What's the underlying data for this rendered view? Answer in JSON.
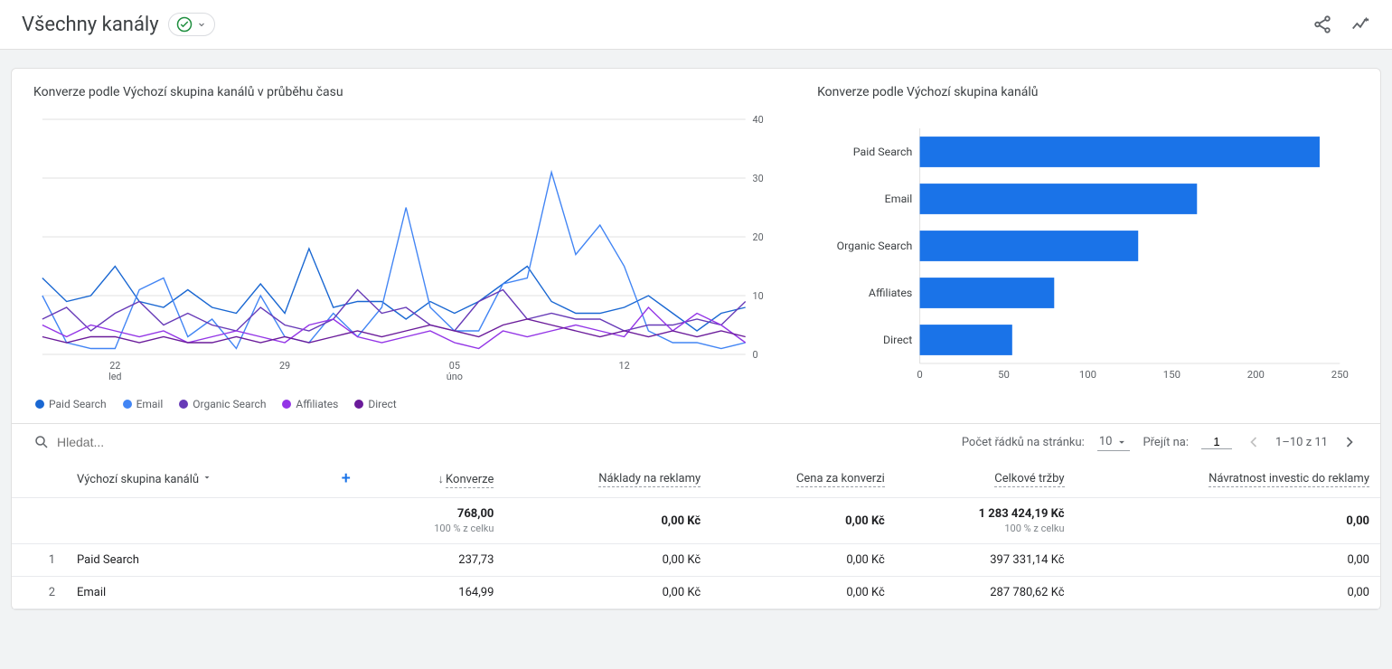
{
  "header": {
    "title": "Všechny kanály"
  },
  "chart_data": [
    {
      "type": "line",
      "title": "Konverze podle Výchozí skupina kanálů v průběhu času",
      "ylabel": "",
      "ylim": [
        0,
        40
      ],
      "yticks": [
        0,
        10,
        20,
        30,
        40
      ],
      "x_ticks": [
        {
          "major": "22",
          "minor": "led"
        },
        {
          "major": "29",
          "minor": ""
        },
        {
          "major": "05",
          "minor": "úno"
        },
        {
          "major": "12",
          "minor": ""
        }
      ],
      "x_tick_positions": [
        3,
        10,
        17,
        24
      ],
      "series": [
        {
          "name": "Paid Search",
          "color": "#1967d2",
          "values": [
            13,
            9,
            10,
            15,
            9,
            8,
            11,
            8,
            7,
            12,
            7,
            18,
            8,
            9,
            9,
            6,
            9,
            7,
            9,
            12,
            15,
            9,
            7,
            7,
            8,
            10,
            7,
            4,
            7,
            8
          ]
        },
        {
          "name": "Email",
          "color": "#4285f4",
          "values": [
            10,
            2,
            1,
            1,
            11,
            13,
            3,
            6,
            1,
            10,
            3,
            2,
            7,
            3,
            8,
            25,
            8,
            4,
            4,
            12,
            13,
            31,
            17,
            22,
            15,
            4,
            2,
            2,
            1,
            2
          ]
        },
        {
          "name": "Organic Search",
          "color": "#673ab7",
          "values": [
            6,
            8,
            4,
            7,
            9,
            5,
            7,
            5,
            4,
            8,
            5,
            4,
            6,
            11,
            7,
            8,
            5,
            4,
            9,
            11,
            6,
            7,
            6,
            6,
            4,
            5,
            5,
            6,
            5,
            9
          ]
        },
        {
          "name": "Affiliates",
          "color": "#9334e6",
          "values": [
            5,
            3,
            5,
            4,
            3,
            4,
            2,
            3,
            4,
            3,
            2,
            5,
            6,
            3,
            2,
            3,
            4,
            2,
            1,
            4,
            3,
            4,
            5,
            4,
            3,
            8,
            4,
            7,
            5,
            2
          ]
        },
        {
          "name": "Direct",
          "color": "#6a1b9a",
          "values": [
            3,
            2,
            3,
            3,
            2,
            3,
            2,
            2,
            3,
            2,
            3,
            2,
            3,
            4,
            3,
            4,
            5,
            4,
            3,
            5,
            6,
            5,
            4,
            3,
            4,
            3,
            4,
            3,
            4,
            3
          ]
        }
      ]
    },
    {
      "type": "bar",
      "orientation": "horizontal",
      "title": "Konverze podle Výchozí skupina kanálů",
      "xlim": [
        0,
        250
      ],
      "xticks": [
        0,
        50,
        100,
        150,
        200,
        250
      ],
      "categories": [
        "Paid Search",
        "Email",
        "Organic Search",
        "Affiliates",
        "Direct"
      ],
      "values": [
        238,
        165,
        130,
        80,
        55
      ]
    }
  ],
  "legend": [
    {
      "name": "Paid Search",
      "color": "#1967d2"
    },
    {
      "name": "Email",
      "color": "#4285f4"
    },
    {
      "name": "Organic Search",
      "color": "#673ab7"
    },
    {
      "name": "Affiliates",
      "color": "#9334e6"
    },
    {
      "name": "Direct",
      "color": "#6a1b9a"
    }
  ],
  "table_toolbar": {
    "search_placeholder": "Hledat...",
    "rows_label": "Počet řádků na stránku:",
    "rows_value": "10",
    "goto_label": "Přejít na:",
    "goto_value": "1",
    "range": "1–10 z 11"
  },
  "table": {
    "dimension_header": "Výchozí skupina kanálů",
    "columns": [
      "Konverze",
      "Náklady na reklamy",
      "Cena za konverzi",
      "Celkové tržby",
      "Návratnost investic do reklamy"
    ],
    "totals": {
      "values": [
        "768,00",
        "0,00 Kč",
        "0,00 Kč",
        "1 283 424,19 Kč",
        "0,00"
      ],
      "subs": [
        "100 % z celku",
        "",
        "",
        "100 % z celku",
        ""
      ]
    },
    "rows": [
      {
        "idx": "1",
        "dim": "Paid Search",
        "values": [
          "237,73",
          "0,00 Kč",
          "0,00 Kč",
          "397 331,14 Kč",
          "0,00"
        ]
      },
      {
        "idx": "2",
        "dim": "Email",
        "values": [
          "164,99",
          "0,00 Kč",
          "0,00 Kč",
          "287 780,62 Kč",
          "0,00"
        ]
      }
    ]
  }
}
